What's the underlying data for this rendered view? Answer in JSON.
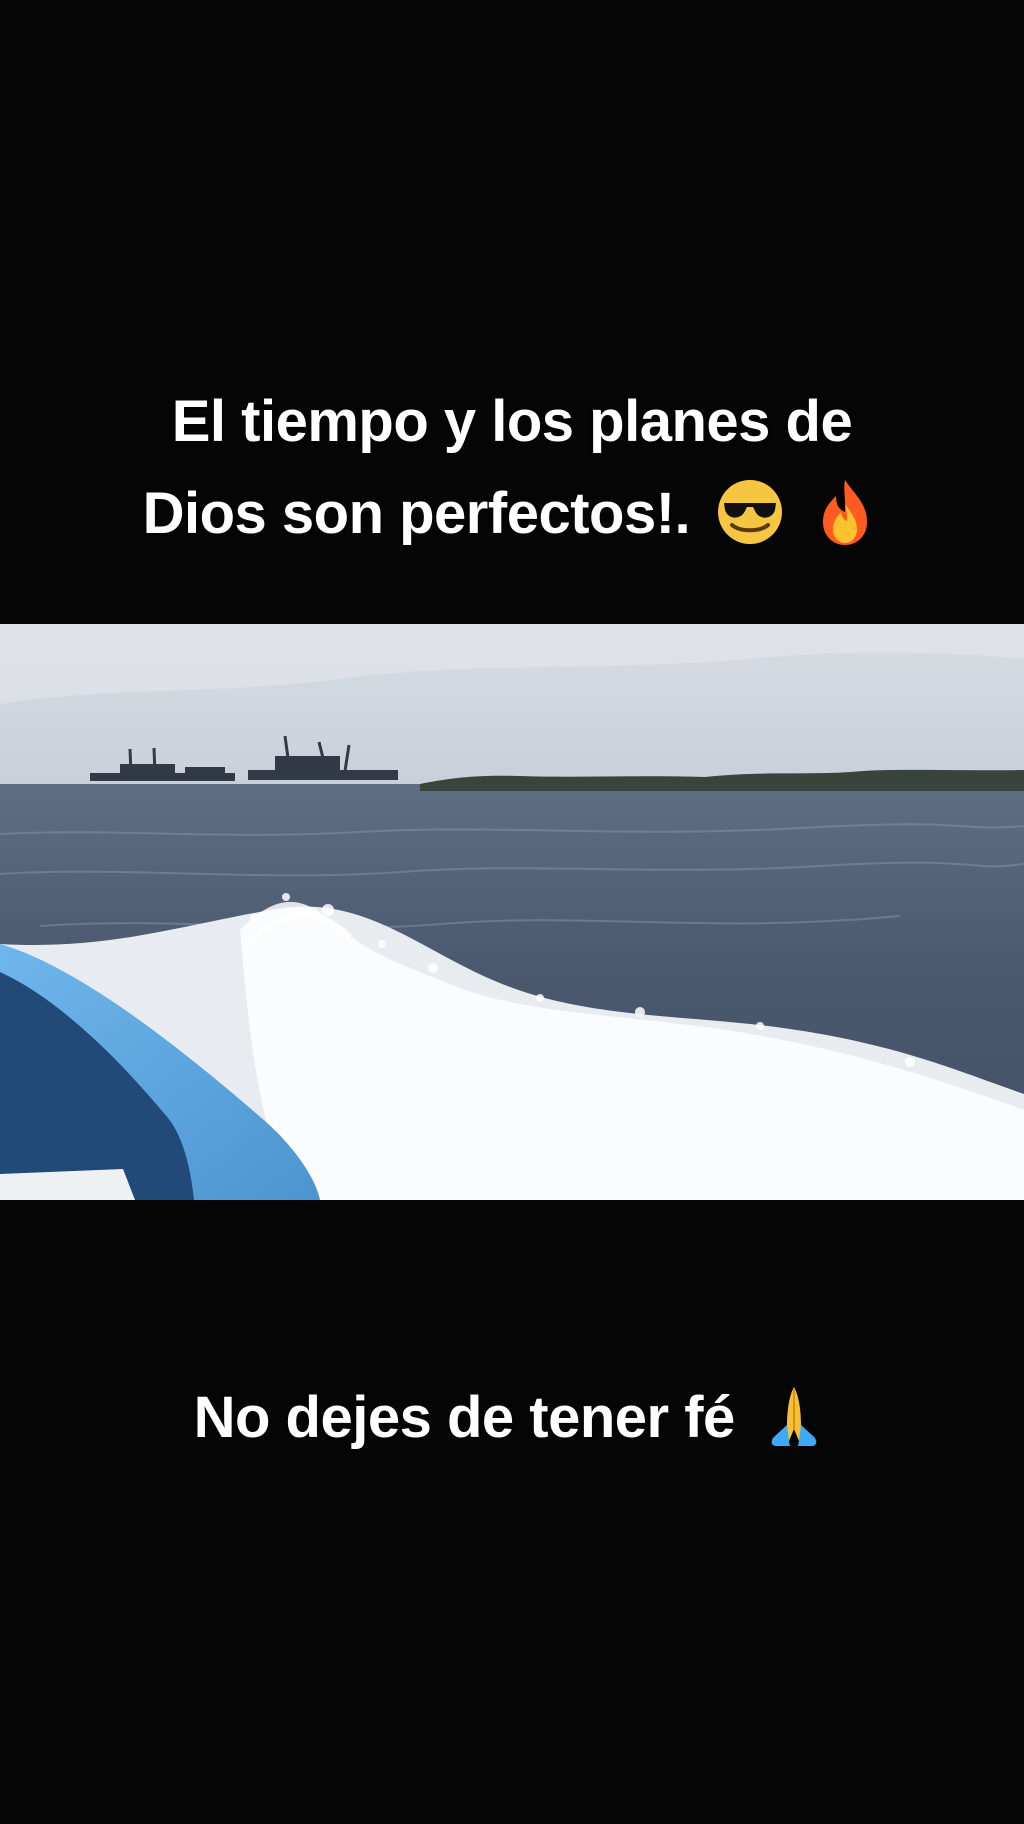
{
  "captions": {
    "top_line_1": "El tiempo y los planes de",
    "top_line_2": "Dios  son perfectos!.",
    "bottom": "No dejes de tener fé"
  },
  "emojis": {
    "top": [
      "smiling-face-with-sunglasses-emoji",
      "fire-emoji"
    ],
    "bottom": [
      "folded-hands-emoji"
    ]
  },
  "colors": {
    "background": "#050505",
    "text": "#ffffff",
    "sky": "#d9dde2",
    "sea": "#4d5b6f",
    "foam": "#e8ecf0",
    "boat": "#5ea4dc"
  }
}
